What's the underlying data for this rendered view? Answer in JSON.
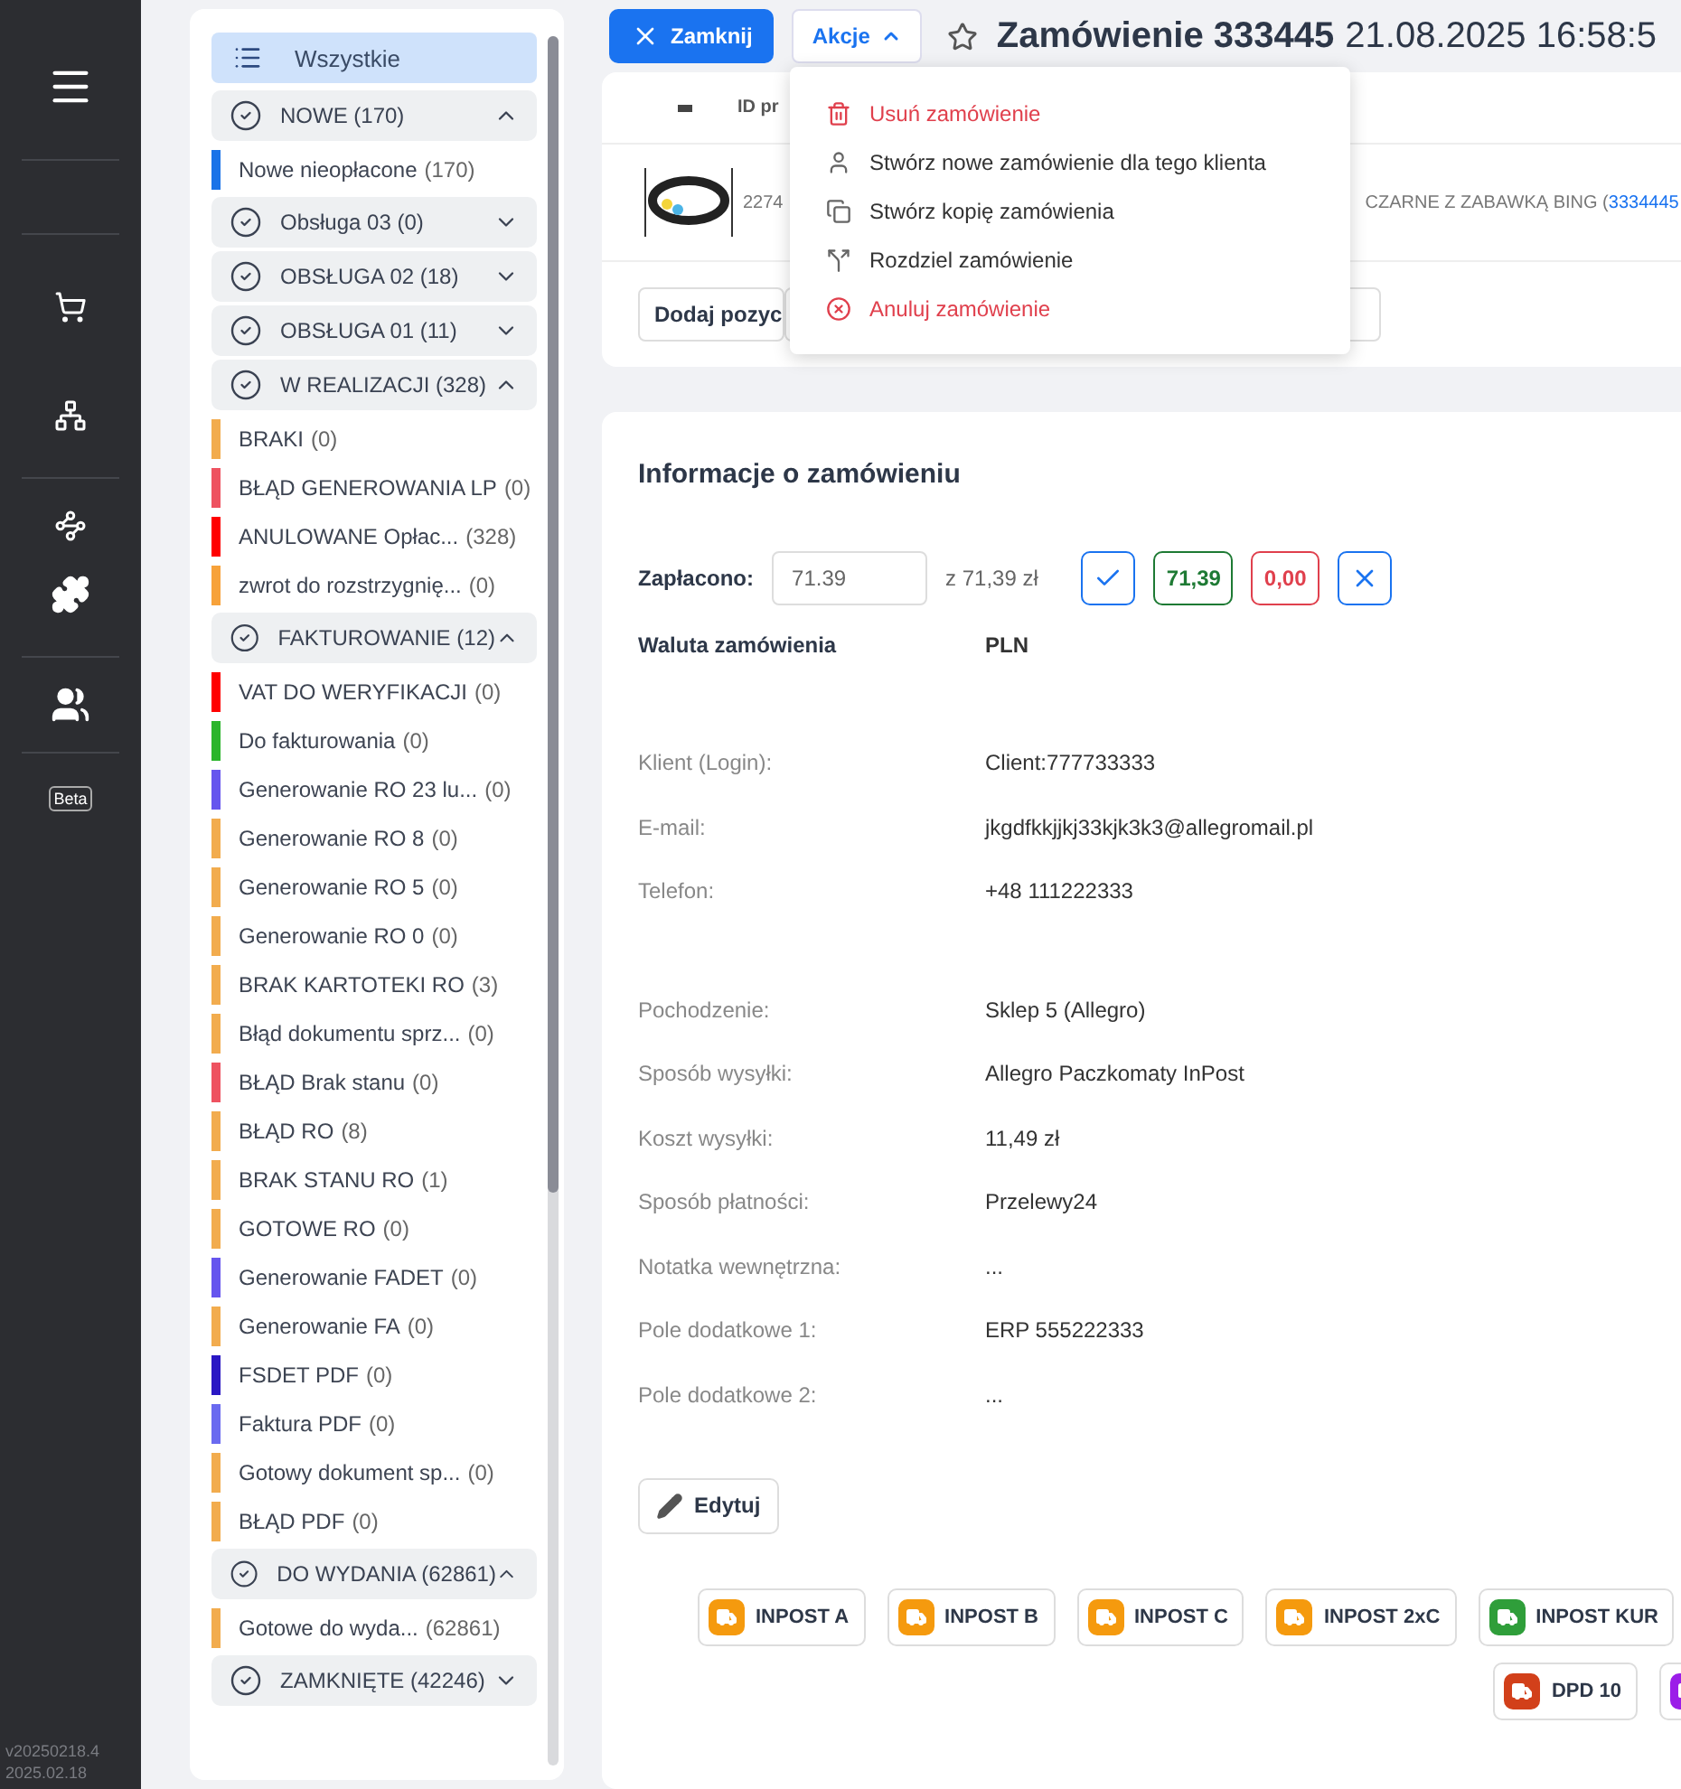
{
  "nav": {
    "beta": "Beta",
    "version": [
      "v20250218.4",
      "2025.02.18"
    ]
  },
  "statuses": {
    "all": {
      "label": "Wszystkie",
      "selected": true
    },
    "groups": [
      {
        "label": "NOWE (170)",
        "expanded": true,
        "children": [
          {
            "name": "Nowe nieopłacone",
            "count": "(170)",
            "color": "#1a73e8"
          }
        ]
      },
      {
        "label": "Obsługa 03 (0)",
        "expanded": false
      },
      {
        "label": "OBSŁUGA 02 (18)",
        "expanded": false
      },
      {
        "label": "OBSŁUGA 01 (11)",
        "expanded": false
      },
      {
        "label": "W REALIZACJI (328)",
        "expanded": true,
        "children": [
          {
            "name": "BRAKI",
            "count": "(0)",
            "color": "#f2ac4e"
          },
          {
            "name": "BŁĄD GENEROWANIA LP",
            "count": "(0)",
            "color": "#ee5260"
          },
          {
            "name": "ANULOWANE Opłac...",
            "count": "(328)",
            "color": "#ff0000"
          },
          {
            "name": "zwrot do rozstrzygnię...",
            "count": "(0)",
            "color": "#f7a23a"
          }
        ]
      },
      {
        "label": "FAKTUROWANIE (12)",
        "expanded": true,
        "children": [
          {
            "name": "VAT DO WERYFIKACJI",
            "count": "(0)",
            "color": "#ff0000"
          },
          {
            "name": "Do fakturowania",
            "count": "(0)",
            "color": "#2bb52b"
          },
          {
            "name": "Generowanie RO 23 lu...",
            "count": "(0)",
            "color": "#6655ee"
          },
          {
            "name": "Generowanie RO 8",
            "count": "(0)",
            "color": "#f2ac4e"
          },
          {
            "name": "Generowanie RO 5",
            "count": "(0)",
            "color": "#f2ac4e"
          },
          {
            "name": "Generowanie RO 0",
            "count": "(0)",
            "color": "#f2ac4e"
          },
          {
            "name": "BRAK KARTOTEKI RO",
            "count": "(3)",
            "color": "#f2ac4e"
          },
          {
            "name": "Błąd dokumentu sprz...",
            "count": "(0)",
            "color": "#f2ac4e"
          },
          {
            "name": "BŁĄD Brak stanu",
            "count": "(0)",
            "color": "#ee5260"
          },
          {
            "name": "BŁĄD RO",
            "count": "(8)",
            "color": "#f2ac4e"
          },
          {
            "name": "BRAK STANU RO",
            "count": "(1)",
            "color": "#f2ac4e"
          },
          {
            "name": "GOTOWE RO",
            "count": "(0)",
            "color": "#f2ac4e"
          },
          {
            "name": "Generowanie FADET",
            "count": "(0)",
            "color": "#6655ee"
          },
          {
            "name": "Generowanie FA",
            "count": "(0)",
            "color": "#f2ac4e"
          },
          {
            "name": "FSDET PDF",
            "count": "(0)",
            "color": "#2a17c4"
          },
          {
            "name": "Faktura PDF",
            "count": "(0)",
            "color": "#6a6af0"
          },
          {
            "name": "Gotowy dokument sp...",
            "count": "(0)",
            "color": "#f2ac4e"
          },
          {
            "name": "BŁĄD PDF",
            "count": "(0)",
            "color": "#f2ac4e"
          }
        ]
      },
      {
        "label": "DO WYDANIA (62861)",
        "expanded": true,
        "children": [
          {
            "name": "Gotowe do wyda...",
            "count": "(62861)",
            "color": "#f2ac4e"
          }
        ]
      },
      {
        "label": "ZAMKNIĘTE (42246)",
        "expanded": false
      }
    ]
  },
  "header": {
    "close": "Zamknij",
    "actions": "Akcje",
    "actions_open": true,
    "title": "Zamówienie 333445",
    "date": "21.08.2025 16:58:5",
    "starred": false
  },
  "actions_menu": [
    {
      "label": "Usuń zamówienie",
      "kind": "delete"
    },
    {
      "label": "Stwórz nowe zamówienie dla tego klienta",
      "kind": "person"
    },
    {
      "label": "Stwórz kopię zamówienia",
      "kind": "copy"
    },
    {
      "label": "Rozdziel zamówienie",
      "kind": "split"
    },
    {
      "label": "Anuluj zamówienie",
      "kind": "cancel"
    }
  ],
  "items": {
    "column_2": "ID pr",
    "row": {
      "id": "2274",
      "name": "CZARNE Z ZABAWKĄ BING (",
      "link": "3334445"
    },
    "add": "Dodaj pozyc"
  },
  "info": {
    "title": "Informacje o zamówieniu",
    "paid": {
      "label": "Zapłacono:",
      "value": "71.39",
      "total": "z 71,39 zł",
      "full": "71,39",
      "zero": "0,00"
    },
    "currency": {
      "label": "Waluta zamówienia",
      "value": "PLN"
    },
    "sections": [
      [
        {
          "label": "Klient (Login):",
          "value": "Client:777733333"
        },
        {
          "label": "E-mail:",
          "value": "jkgdfkkjjkj33kjk3k3@allegromail.pl"
        },
        {
          "label": "Telefon:",
          "value": "+48 111222333"
        }
      ],
      [
        {
          "label": "Pochodzenie:",
          "value": "Sklep 5 (Allegro)"
        },
        {
          "label": "Sposób wysyłki:",
          "value": "Allegro Paczkomaty InPost"
        },
        {
          "label": "Koszt wysyłki:",
          "value": "11,49 zł"
        },
        {
          "label": "Sposób płatności:",
          "value": "Przelewy24"
        },
        {
          "label": "Notatka wewnętrzna:",
          "value": "..."
        },
        {
          "label": "Pole dodatkowe 1:",
          "value": "ERP 555222333"
        },
        {
          "label": "Pole dodatkowe 2:",
          "value": "..."
        }
      ]
    ],
    "edit": "Edytuj",
    "carrier_rows": [
      [
        {
          "label": "INPOST A",
          "color": "#f59a0e"
        },
        {
          "label": "INPOST B",
          "color": "#f59a0e"
        },
        {
          "label": "INPOST C",
          "color": "#f59a0e"
        },
        {
          "label": "INPOST 2xC",
          "color": "#f59a0e"
        },
        {
          "label": "INPOST KUR",
          "color": "#2f9e3a"
        }
      ],
      [
        {
          "label": "DPD 10",
          "color": "#d2401a"
        },
        {
          "color": "#9b1de8"
        }
      ]
    ]
  }
}
